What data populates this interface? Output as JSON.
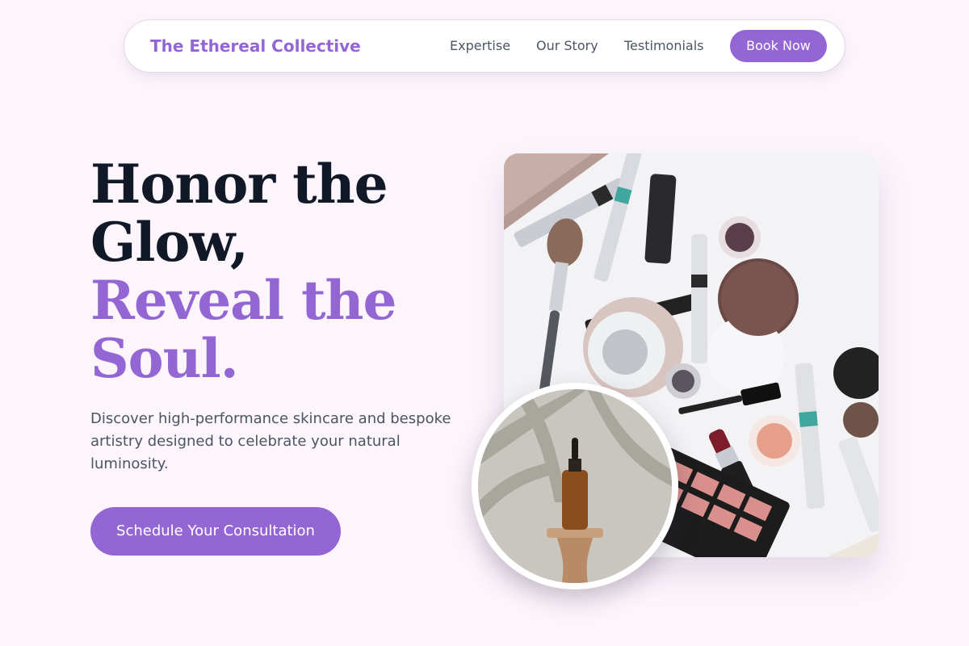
{
  "nav": {
    "brand": "The Ethereal Collective",
    "links": [
      "Expertise",
      "Our Story",
      "Testimonials"
    ],
    "cta_label": "Book Now"
  },
  "hero": {
    "headline_line1": "Honor the",
    "headline_line2": "Glow,",
    "headline_line3": "Reveal the",
    "headline_line4": "Soul.",
    "subtext": "Discover high-performance skincare and bespoke artistry designed to celebrate your natural luminosity.",
    "cta_label": "Schedule Your Consultation"
  },
  "images": {
    "main": "makeup-flatlay-image",
    "inset": "serum-bottle-image"
  },
  "colors": {
    "accent": "#9466d4",
    "background": "#fdf5fc",
    "heading": "#111827",
    "body_text": "#4b5563"
  }
}
